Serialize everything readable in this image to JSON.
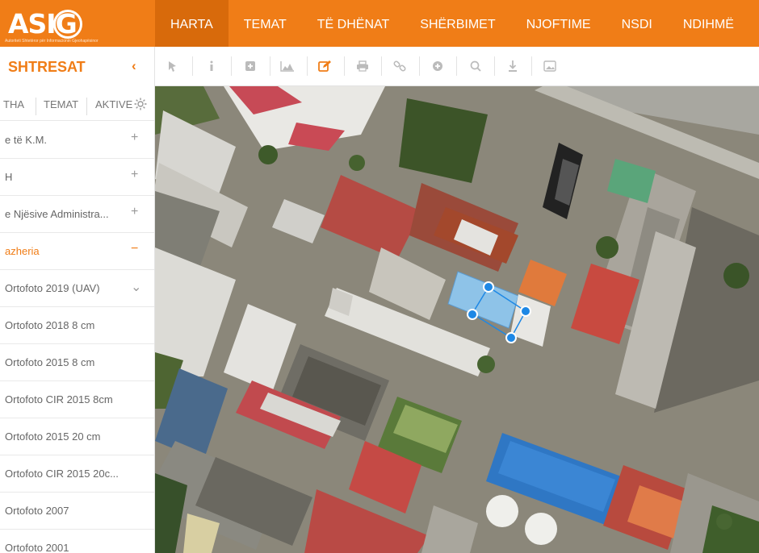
{
  "header": {
    "logo_text": "ASIG",
    "logo_subtitle": "Autoriteti Shtetëror për Informacionin Gjeohapësinor",
    "nav": [
      {
        "label": "HARTA",
        "active": true
      },
      {
        "label": "TEMAT",
        "active": false
      },
      {
        "label": "TË DHËNAT",
        "active": false
      },
      {
        "label": "SHËRBIMET",
        "active": false
      },
      {
        "label": "NJOFTIME",
        "active": false
      },
      {
        "label": "NSDI",
        "active": false
      },
      {
        "label": "NDIHMË",
        "active": false
      }
    ]
  },
  "sidebar": {
    "title": "SHTRESAT",
    "collapse_icon": "chevron-left",
    "tabs": [
      {
        "label": "THA"
      },
      {
        "label": "TEMAT"
      },
      {
        "label": "AKTIVE"
      }
    ],
    "settings_icon": "gear-icon",
    "layers": [
      {
        "label": "e të K.M.",
        "control": "+",
        "active": false
      },
      {
        "label": "H",
        "control": "+",
        "active": false
      },
      {
        "label": "e Njësive Administra...",
        "control": "+",
        "active": false
      },
      {
        "label": "azheria",
        "control": "−",
        "active": true
      },
      {
        "label": "Ortofoto 2019 (UAV)",
        "control": "⌄",
        "active": false
      },
      {
        "label": "Ortofoto 2018 8 cm",
        "control": "",
        "active": false
      },
      {
        "label": "Ortofoto 2015 8 cm",
        "control": "",
        "active": false
      },
      {
        "label": "Ortofoto CIR 2015 8cm",
        "control": "",
        "active": false
      },
      {
        "label": "Ortofoto 2015 20 cm",
        "control": "",
        "active": false
      },
      {
        "label": "Ortofoto CIR 2015 20c...",
        "control": "",
        "active": false
      },
      {
        "label": "Ortofoto 2007",
        "control": "",
        "active": false
      },
      {
        "label": "Ortofoto 2001",
        "control": "",
        "active": false
      }
    ]
  },
  "toolbar": {
    "tools": [
      {
        "name": "select-pointer-icon"
      },
      {
        "name": "info-icon"
      },
      {
        "name": "add-square-icon"
      },
      {
        "name": "elevation-profile-icon"
      },
      {
        "name": "edit-icon"
      },
      {
        "name": "print-icon"
      },
      {
        "name": "link-icon"
      },
      {
        "name": "add-circle-icon"
      },
      {
        "name": "search-icon"
      },
      {
        "name": "download-icon"
      },
      {
        "name": "image-icon"
      }
    ]
  },
  "colors": {
    "brand_orange": "#f07d17",
    "active_nav": "#d86a0b",
    "selection_marker": "#1e88e5"
  }
}
